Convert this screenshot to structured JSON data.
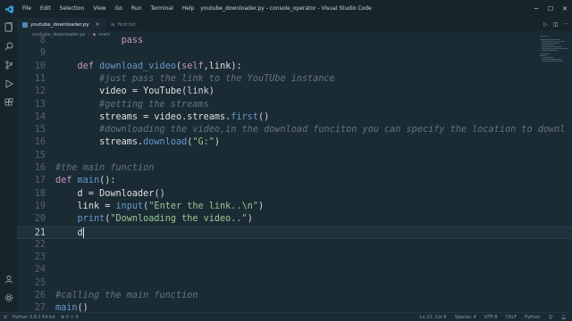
{
  "titlebar": {
    "menu": [
      "File",
      "Edit",
      "Selection",
      "View",
      "Go",
      "Run",
      "Terminal",
      "Help"
    ],
    "window_title": "youtube_downloader.py - console_operator - Visual Studio Code"
  },
  "tabs": [
    {
      "label": "youtube_downloader.py"
    },
    {
      "label": "first.txt"
    }
  ],
  "breadcrumb": {
    "file": "youtube_downloader.py",
    "symbol": "main"
  },
  "code_lines": [
    {
      "num": "8",
      "tokens": [
        {
          "t": "            ",
          "c": "pl"
        },
        {
          "t": "pass",
          "c": "kw"
        }
      ]
    },
    {
      "num": "9",
      "tokens": []
    },
    {
      "num": "10",
      "tokens": [
        {
          "t": "    ",
          "c": "pl"
        },
        {
          "t": "def ",
          "c": "kw"
        },
        {
          "t": "download_video",
          "c": "fn"
        },
        {
          "t": "(",
          "c": "pl"
        },
        {
          "t": "self",
          "c": "kw"
        },
        {
          "t": ",",
          "c": "pl"
        },
        {
          "t": "link",
          "c": "var"
        },
        {
          "t": "):",
          "c": "pl"
        }
      ]
    },
    {
      "num": "11",
      "tokens": [
        {
          "t": "        ",
          "c": "pl"
        },
        {
          "t": "#just pass the link to the YouTUbe instance",
          "c": "cm"
        }
      ]
    },
    {
      "num": "12",
      "tokens": [
        {
          "t": "        ",
          "c": "pl"
        },
        {
          "t": "video = ",
          "c": "var"
        },
        {
          "t": "YouTube",
          "c": "var"
        },
        {
          "t": "(link)",
          "c": "pl"
        }
      ]
    },
    {
      "num": "13",
      "tokens": [
        {
          "t": "        ",
          "c": "pl"
        },
        {
          "t": "#getting the streams",
          "c": "cm"
        }
      ]
    },
    {
      "num": "14",
      "tokens": [
        {
          "t": "        ",
          "c": "pl"
        },
        {
          "t": "streams = video.streams.",
          "c": "var"
        },
        {
          "t": "first",
          "c": "fn"
        },
        {
          "t": "()",
          "c": "pl"
        }
      ]
    },
    {
      "num": "15",
      "tokens": [
        {
          "t": "        ",
          "c": "pl"
        },
        {
          "t": "#downloading the video,in the download funciton you can specify the location to downl",
          "c": "cm"
        }
      ]
    },
    {
      "num": "16",
      "tokens": [
        {
          "t": "        ",
          "c": "pl"
        },
        {
          "t": "streams.",
          "c": "var"
        },
        {
          "t": "download",
          "c": "fn"
        },
        {
          "t": "(",
          "c": "pl"
        },
        {
          "t": "\"G:\"",
          "c": "str"
        },
        {
          "t": ")",
          "c": "pl"
        }
      ]
    },
    {
      "num": "15",
      "tokens": []
    },
    {
      "num": "16",
      "tokens": [
        {
          "t": "#the main function",
          "c": "cm"
        }
      ]
    },
    {
      "num": "17",
      "tokens": [
        {
          "t": "def ",
          "c": "kw"
        },
        {
          "t": "main",
          "c": "fn"
        },
        {
          "t": "():",
          "c": "pl"
        }
      ]
    },
    {
      "num": "18",
      "tokens": [
        {
          "t": "    ",
          "c": "pl"
        },
        {
          "t": "d = ",
          "c": "var"
        },
        {
          "t": "Downloader",
          "c": "var"
        },
        {
          "t": "()",
          "c": "pl"
        }
      ]
    },
    {
      "num": "19",
      "tokens": [
        {
          "t": "    ",
          "c": "pl"
        },
        {
          "t": "link = ",
          "c": "var"
        },
        {
          "t": "input",
          "c": "fn"
        },
        {
          "t": "(",
          "c": "pl"
        },
        {
          "t": "\"Enter the link..\\n\"",
          "c": "str"
        },
        {
          "t": ")",
          "c": "pl"
        }
      ]
    },
    {
      "num": "20",
      "tokens": [
        {
          "t": "    ",
          "c": "pl"
        },
        {
          "t": "print",
          "c": "fn"
        },
        {
          "t": "(",
          "c": "pl"
        },
        {
          "t": "\"Downloading the video..\"",
          "c": "str"
        },
        {
          "t": ")",
          "c": "pl"
        }
      ]
    },
    {
      "num": "21",
      "tokens": [
        {
          "t": "    ",
          "c": "pl"
        },
        {
          "t": "d",
          "c": "var"
        }
      ],
      "current": true
    },
    {
      "num": "22",
      "tokens": []
    },
    {
      "num": "23",
      "tokens": []
    },
    {
      "num": "24",
      "tokens": []
    },
    {
      "num": "25",
      "tokens": []
    },
    {
      "num": "26",
      "tokens": [
        {
          "t": "#calling the main function",
          "c": "cm"
        }
      ]
    },
    {
      "num": "27",
      "tokens": [
        {
          "t": "main",
          "c": "fn"
        },
        {
          "t": "()",
          "c": "pl"
        }
      ]
    }
  ],
  "statusbar": {
    "left": [
      "Python 3.9.2 64-bit",
      "⊗ 0 ⚠ 0"
    ],
    "right": [
      "Ln 21, Col 6",
      "Spaces: 4",
      "UTF-8",
      "CRLF",
      "Python"
    ]
  },
  "colors": {
    "background": "#1b2b34",
    "keyword": "#c594c5",
    "function": "#6699cc",
    "string": "#99c794",
    "comment": "#65737e"
  }
}
